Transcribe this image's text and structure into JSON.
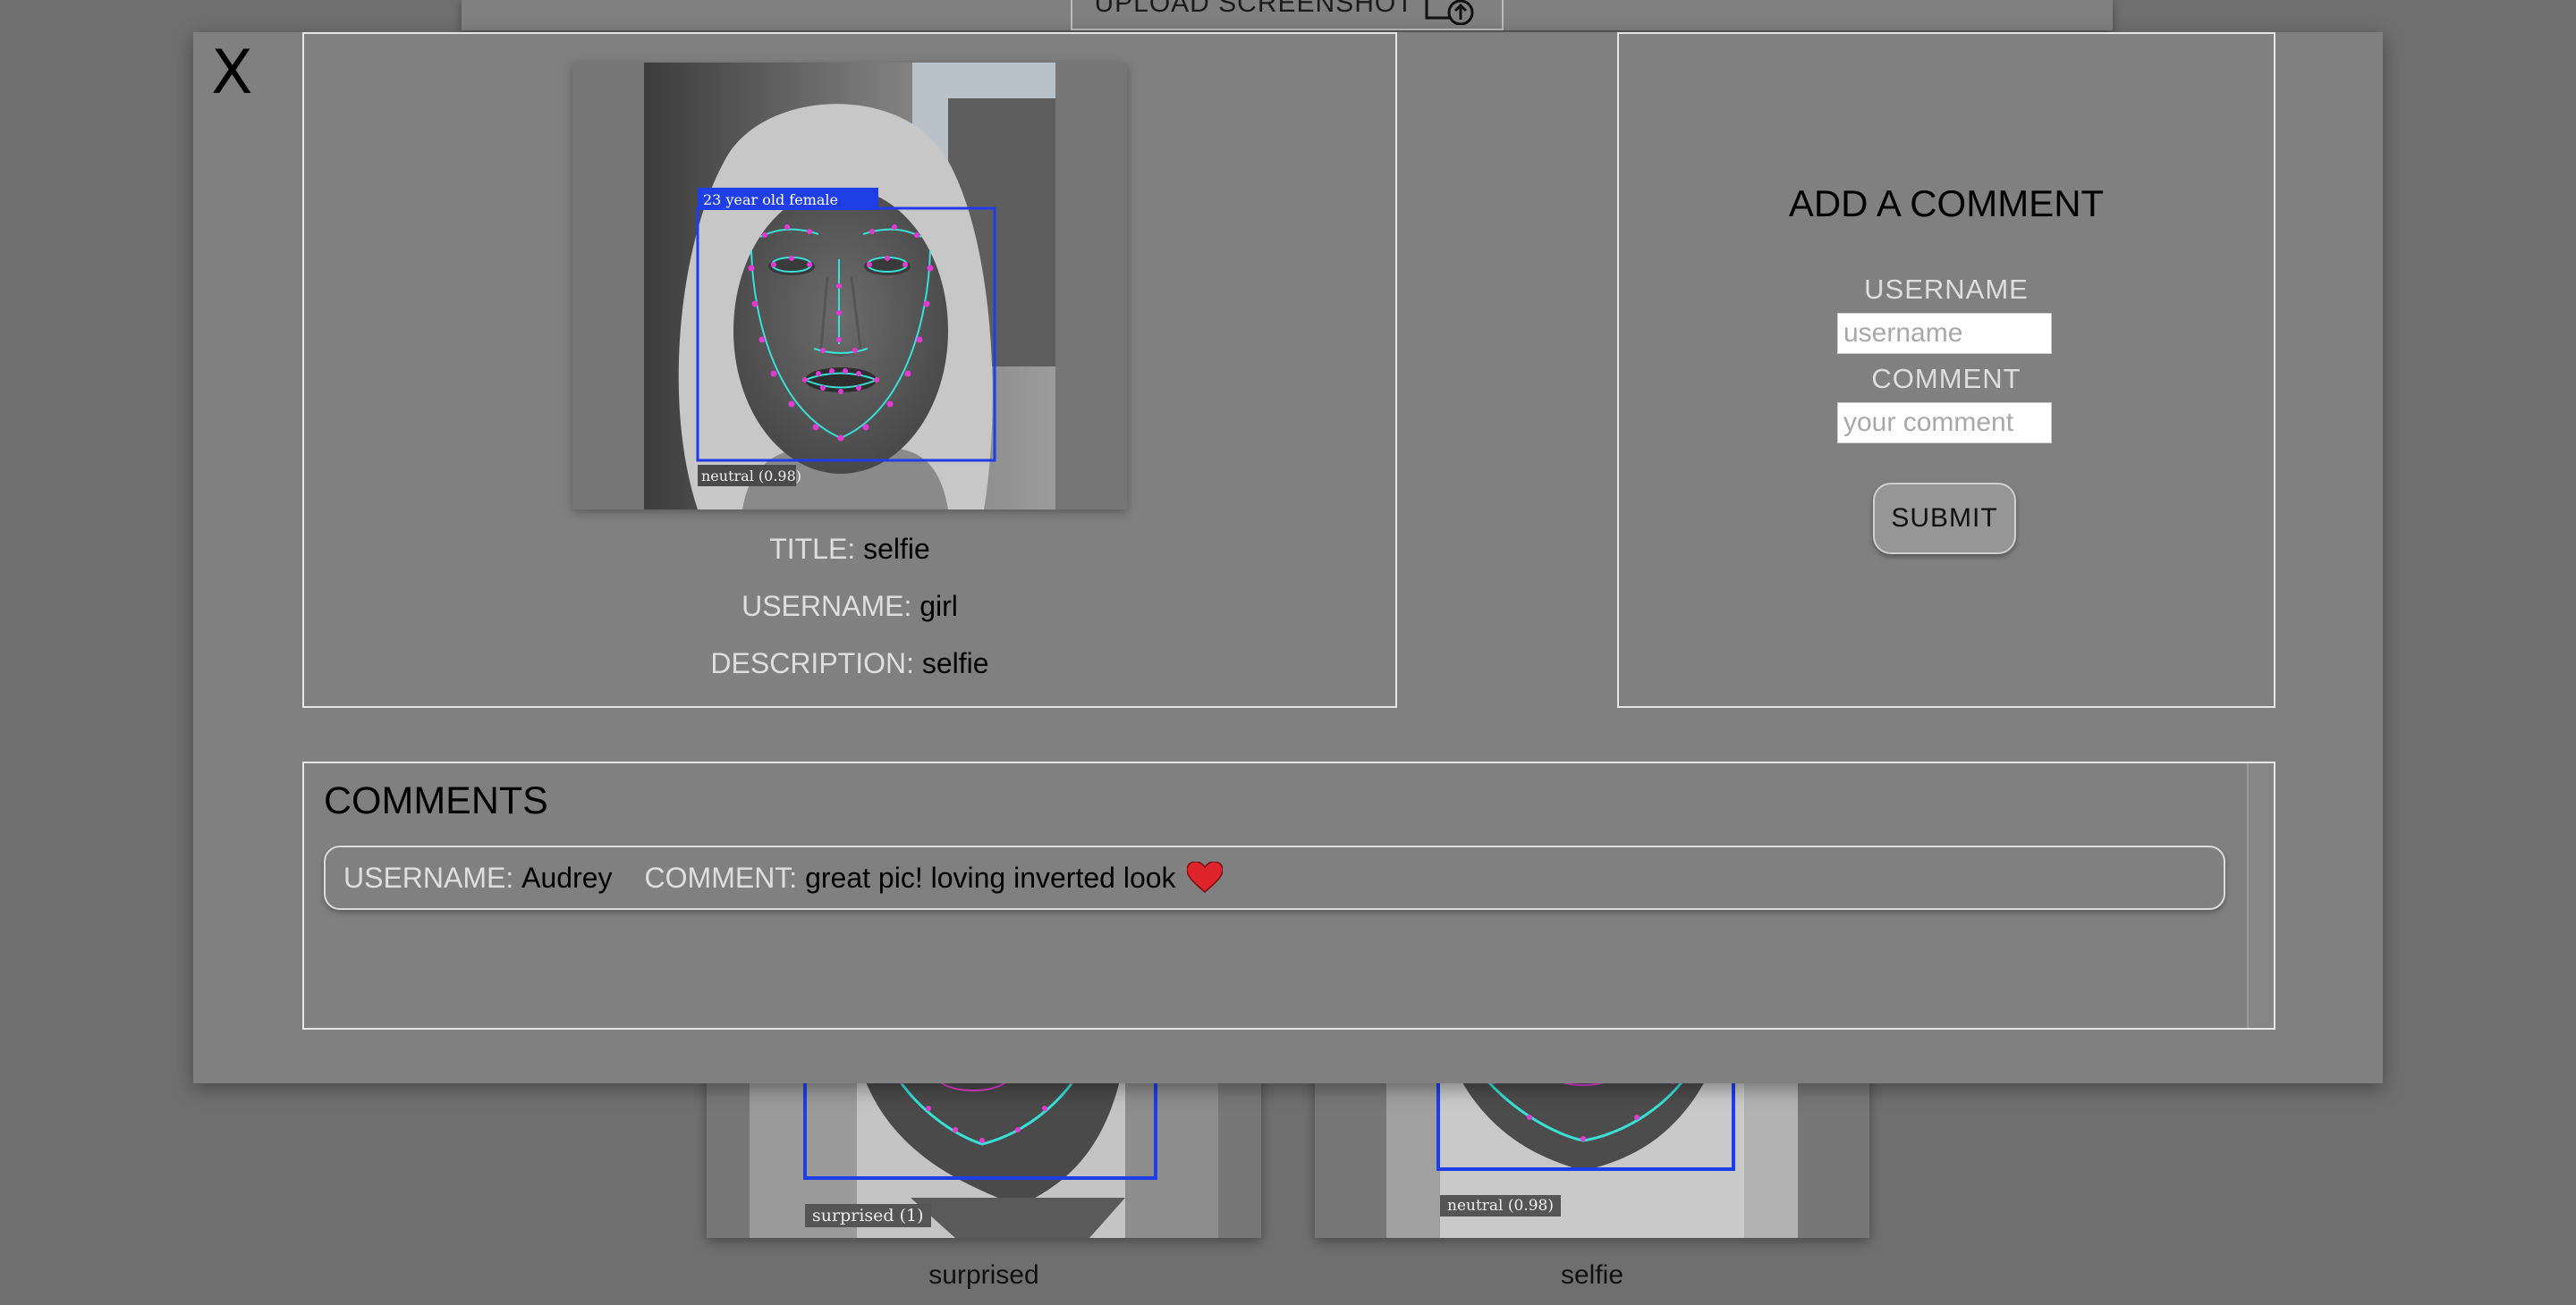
{
  "background": {
    "upload_label": "UPLOAD SCREENSHOT",
    "cards": [
      {
        "caption": "surprised",
        "overlay_label": "surprised (1)"
      },
      {
        "caption": "selfie",
        "overlay_label": "neutral (0.98)"
      }
    ]
  },
  "modal": {
    "close_label": "X",
    "post": {
      "age_label": "23 year old female",
      "emotion_label": "neutral (0.98)",
      "title_key": "TITLE:",
      "title_value": "selfie",
      "username_key": "USERNAME:",
      "username_value": "girl",
      "description_key": "DESCRIPTION:",
      "description_value": "selfie"
    },
    "form": {
      "title": "ADD A COMMENT",
      "username_label": "USERNAME",
      "username_placeholder": "username",
      "comment_label": "COMMENT",
      "comment_placeholder": "your comment",
      "submit_label": "SUBMIT"
    },
    "comments": {
      "title": "COMMENTS",
      "items": [
        {
          "username_key": "USERNAME:",
          "username": "Audrey",
          "comment_key": "COMMENT:",
          "comment": "great pic! loving inverted look",
          "emoji": "❤️"
        }
      ]
    }
  },
  "colors": {
    "overlay_box": "#1f3ee6",
    "landmarks_line": "#38e0d8",
    "landmarks_dot": "#e23ad2"
  }
}
